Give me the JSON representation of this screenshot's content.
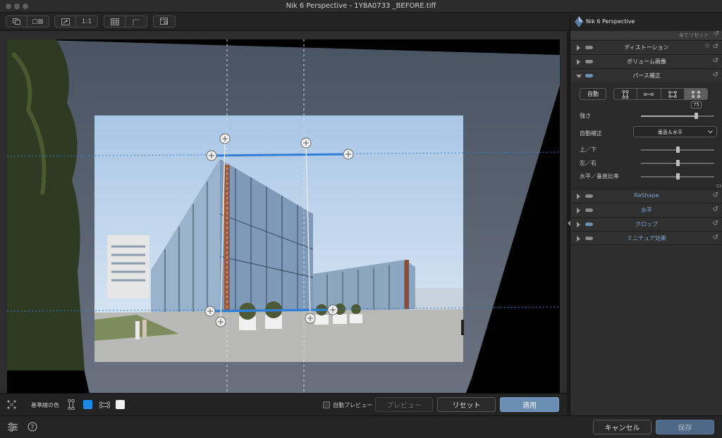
{
  "window": {
    "title": "Nik 6 Perspective - 1Y8A0733 _BEFORE.tiff"
  },
  "toolbar": {
    "zoom_label": "1:1"
  },
  "panel": {
    "brand": "Nik 6 Perspective",
    "reset_all": "全てリセット",
    "sections": [
      {
        "title": "ディストーション",
        "accent": false
      },
      {
        "title": "ボリューム画像",
        "accent": false
      },
      {
        "title": "パース補正",
        "accent": false
      },
      {
        "title": "ReShape",
        "accent": true
      },
      {
        "title": "水平",
        "accent": true
      },
      {
        "title": "クロップ",
        "accent": true
      },
      {
        "title": "ミニチュア効果",
        "accent": true
      }
    ],
    "perspective": {
      "auto_button": "自動",
      "strength_label": "強さ",
      "strength_value": "75",
      "auto_correction_label": "自動補正",
      "auto_correction_value": "垂直＆水平",
      "up_down_label": "上／下",
      "left_right_label": "左／右",
      "ratio_label": "水平／垂直比率",
      "strength_level": 0.75,
      "up_down_level": 0.5,
      "left_right_level": 0.5,
      "ratio_level": 0.5
    }
  },
  "bottombar": {
    "guide_color_label": "基準線の色",
    "auto_preview_label": "自動プレビュー",
    "preview_button": "プレビュー",
    "reset_button": "リセット",
    "apply_button": "適用",
    "swatch_blue": "#1e8ae8",
    "swatch_white": "#f0f0f0"
  },
  "footer": {
    "cancel_button": "キャンセル",
    "save_button": "保存"
  },
  "colors": {
    "accent": "#6b8fb3",
    "guide_line": "#2f7fd6"
  }
}
